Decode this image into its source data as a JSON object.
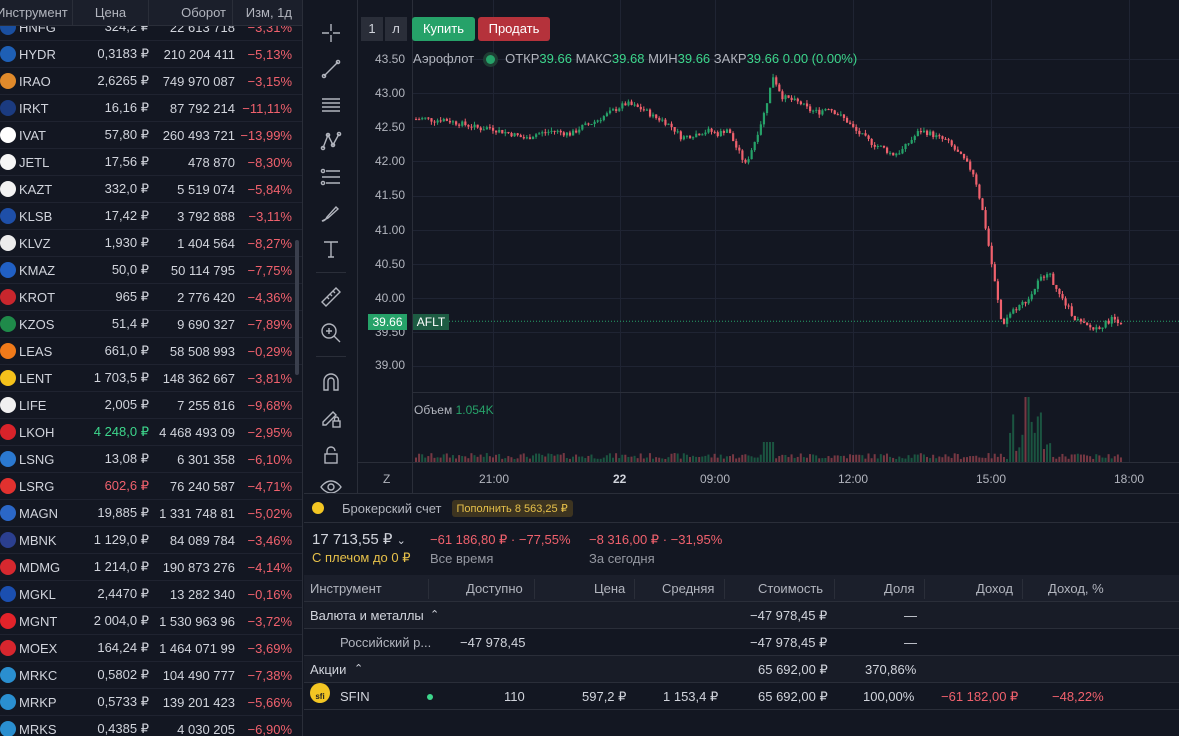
{
  "watchlist": {
    "headers": {
      "instrument": "Инструмент",
      "price": "Цена",
      "turnover": "Оборот",
      "change": "Изм, 1д"
    },
    "rows": [
      {
        "ticker": "HNFG",
        "price": "324,2 ₽",
        "turnover": "22 613 718",
        "change": "−3,31%",
        "logo_color": "#1a4fa0",
        "price_color": ""
      },
      {
        "ticker": "HYDR",
        "price": "0,3183 ₽",
        "turnover": "210 204 411",
        "change": "−5,13%",
        "logo_color": "#1e5fb5",
        "price_color": ""
      },
      {
        "ticker": "IRAO",
        "price": "2,6265 ₽",
        "turnover": "749 970 087",
        "change": "−3,15%",
        "logo_color": "#e08a2b",
        "price_color": ""
      },
      {
        "ticker": "IRKT",
        "price": "16,16 ₽",
        "turnover": "87 792 214",
        "change": "−11,11%",
        "logo_color": "#1b3b80",
        "price_color": ""
      },
      {
        "ticker": "IVAT",
        "price": "57,80 ₽",
        "turnover": "260 493 721",
        "change": "−13,99%",
        "logo_color": "#ffffff",
        "price_color": ""
      },
      {
        "ticker": "JETL",
        "price": "17,56 ₽",
        "turnover": "478 870",
        "change": "−8,30%",
        "logo_color": "#f5f5f5",
        "price_color": ""
      },
      {
        "ticker": "KAZT",
        "price": "332,0 ₽",
        "turnover": "5 519 074",
        "change": "−5,84%",
        "logo_color": "#f2f2f2",
        "price_color": ""
      },
      {
        "ticker": "KLSB",
        "price": "17,42 ₽",
        "turnover": "3 792 888",
        "change": "−3,11%",
        "logo_color": "#1e4fa8",
        "price_color": ""
      },
      {
        "ticker": "KLVZ",
        "price": "1,930 ₽",
        "turnover": "1 404 564",
        "change": "−8,27%",
        "logo_color": "#ececec",
        "price_color": ""
      },
      {
        "ticker": "KMAZ",
        "price": "50,0 ₽",
        "turnover": "50 114 795",
        "change": "−7,75%",
        "logo_color": "#2160c4",
        "price_color": ""
      },
      {
        "ticker": "KROT",
        "price": "965 ₽",
        "turnover": "2 776 420",
        "change": "−4,36%",
        "logo_color": "#c8262d",
        "price_color": ""
      },
      {
        "ticker": "KZOS",
        "price": "51,4 ₽",
        "turnover": "9 690 327",
        "change": "−7,89%",
        "logo_color": "#1f8a4a",
        "price_color": ""
      },
      {
        "ticker": "LEAS",
        "price": "661,0 ₽",
        "turnover": "58 508 993",
        "change": "−0,29%",
        "logo_color": "#f07a1a",
        "price_color": ""
      },
      {
        "ticker": "LENT",
        "price": "1 703,5 ₽",
        "turnover": "148 362 667",
        "change": "−3,81%",
        "logo_color": "#f5c21b",
        "price_color": ""
      },
      {
        "ticker": "LIFE",
        "price": "2,005 ₽",
        "turnover": "7 255 816",
        "change": "−9,68%",
        "logo_color": "#f0f0f0",
        "price_color": ""
      },
      {
        "ticker": "LKOH",
        "price": "4 248,0 ₽",
        "turnover": "4 468 493 09",
        "change": "−2,95%",
        "logo_color": "#d8232a",
        "price_color": "green"
      },
      {
        "ticker": "LSNG",
        "price": "13,08 ₽",
        "turnover": "6 301 358",
        "change": "−6,10%",
        "logo_color": "#2b79d0",
        "price_color": ""
      },
      {
        "ticker": "LSRG",
        "price": "602,6 ₽",
        "turnover": "76 240 587",
        "change": "−4,71%",
        "logo_color": "#e2312f",
        "price_color": "red"
      },
      {
        "ticker": "MAGN",
        "price": "19,885 ₽",
        "turnover": "1 331 748 81",
        "change": "−5,02%",
        "logo_color": "#2b67c7",
        "price_color": ""
      },
      {
        "ticker": "MBNK",
        "price": "1 129,0 ₽",
        "turnover": "84 089 784",
        "change": "−3,46%",
        "logo_color": "#2b3f8f",
        "price_color": ""
      },
      {
        "ticker": "MDMG",
        "price": "1 214,0 ₽",
        "turnover": "190 873 276",
        "change": "−4,14%",
        "logo_color": "#d6282f",
        "price_color": ""
      },
      {
        "ticker": "MGKL",
        "price": "2,4470 ₽",
        "turnover": "13 282 340",
        "change": "−0,16%",
        "logo_color": "#1b4fb0",
        "price_color": ""
      },
      {
        "ticker": "MGNT",
        "price": "2 004,0 ₽",
        "turnover": "1 530 963 96",
        "change": "−3,72%",
        "logo_color": "#e2232a",
        "price_color": ""
      },
      {
        "ticker": "MOEX",
        "price": "164,24 ₽",
        "turnover": "1 464 071 99",
        "change": "−3,69%",
        "logo_color": "#d7262e",
        "price_color": ""
      },
      {
        "ticker": "MRKC",
        "price": "0,5802 ₽",
        "turnover": "104 490 777",
        "change": "−7,38%",
        "logo_color": "#2a8fd0",
        "price_color": ""
      },
      {
        "ticker": "MRKP",
        "price": "0,5733 ₽",
        "turnover": "139 201 423",
        "change": "−5,66%",
        "logo_color": "#2a8fd0",
        "price_color": ""
      },
      {
        "ticker": "MRKS",
        "price": "0,4385 ₽",
        "turnover": "4 030 205",
        "change": "−6,90%",
        "logo_color": "#2a8fd0",
        "price_color": ""
      }
    ]
  },
  "toolbar": {
    "icons": [
      "crosshair-icon",
      "trend-line-icon",
      "horizontal-lines-icon",
      "pattern-icon",
      "fib-icon",
      "brush-icon",
      "text-icon",
      "ruler-icon",
      "zoom-in-icon",
      "magnet-icon",
      "lock-drawing-icon",
      "lock-icon",
      "eye-icon"
    ]
  },
  "chart": {
    "timeframe_1": "1",
    "timeframe_2": "л",
    "buy_label": "Купить",
    "sell_label": "Продать",
    "symbol_name": "Аэрофлот",
    "open_label": "ОТКР",
    "open_value": "39.66",
    "high_label": "МАКС",
    "high_value": "39.68",
    "low_label": "МИН",
    "low_value": "39.66",
    "close_label": "ЗАКР",
    "close_value": "39.66",
    "change_value": "0.00 (0.00%)",
    "volume_label": "Объем",
    "volume_value": "1.054K",
    "last_price": "39.66",
    "ticker_tag": "AFLT",
    "y_ticks": [
      "43.50",
      "43.00",
      "42.50",
      "42.00",
      "41.50",
      "41.00",
      "40.50",
      "40.00",
      "39.50",
      "39.00"
    ],
    "x_ticks": [
      "21:00",
      "22",
      "09:00",
      "12:00",
      "15:00",
      "18:00"
    ],
    "zoom_label": "Z",
    "up_color": "#26a269",
    "down_color": "#f0616d"
  },
  "chart_data": {
    "type": "candlestick",
    "symbol": "AFLT",
    "ylim": [
      38.8,
      43.6
    ],
    "x_ticks": [
      "21:00",
      "22",
      "09:00",
      "12:00",
      "15:00",
      "18:00"
    ],
    "close_path": [
      42.62,
      42.63,
      42.6,
      42.62,
      42.58,
      42.55,
      42.52,
      42.48,
      42.5,
      42.45,
      42.42,
      42.38,
      42.33,
      42.4,
      42.42,
      42.45,
      42.42,
      42.4,
      42.5,
      42.55,
      42.62,
      42.7,
      42.78,
      42.85,
      42.8,
      42.75,
      42.65,
      42.6,
      42.5,
      42.35,
      42.38,
      42.42,
      42.45,
      42.4,
      42.48,
      42.2,
      41.95,
      42.3,
      42.7,
      43.25,
      42.95,
      42.9,
      42.85,
      42.75,
      42.72,
      42.8,
      42.7,
      42.6,
      42.45,
      42.35,
      42.25,
      42.2,
      42.1,
      42.15,
      42.3,
      42.45,
      42.42,
      42.35,
      42.3,
      42.15,
      42.0,
      41.8,
      41.2,
      40.4,
      39.6,
      39.8,
      39.9,
      40.0,
      40.25,
      40.4,
      40.1,
      39.9,
      39.7,
      39.6,
      39.55,
      39.6,
      39.7,
      39.66
    ],
    "volume_peak": "1.054K"
  },
  "portfolio": {
    "account_name": "Брокерский счет",
    "topup_label": "Пополнить 8 563,25 ₽",
    "total": "17 713,55 ₽",
    "leverage": "С плечом до 0 ₽",
    "all_time_value": "−61 186,80 ₽ · −77,55%",
    "all_time_label": "Все время",
    "today_value": "−8 316,00 ₽ · −31,95%",
    "today_label": "За сегодня",
    "columns": [
      "Инструмент",
      "Доступно",
      "Цена",
      "Средняя",
      "Стоимость",
      "Доля",
      "Доход",
      "Доход, %"
    ],
    "groups": {
      "currency": {
        "title": "Валюта и металлы",
        "cost": "−47 978,45 ₽",
        "share": "—"
      },
      "rub": {
        "name": "Российский р...",
        "available": "−47 978,45",
        "cost": "−47 978,45 ₽",
        "share": "—"
      },
      "shares": {
        "title": "Акции",
        "cost": "65 692,00 ₽",
        "share": "370,86%"
      },
      "sfin": {
        "name": "SFIN",
        "available": "110",
        "price": "597,2 ₽",
        "average": "1 153,4 ₽",
        "cost": "65 692,00 ₽",
        "share": "100,00%",
        "income": "−61 182,00 ₽",
        "income_pct": "−48,22%"
      }
    }
  }
}
